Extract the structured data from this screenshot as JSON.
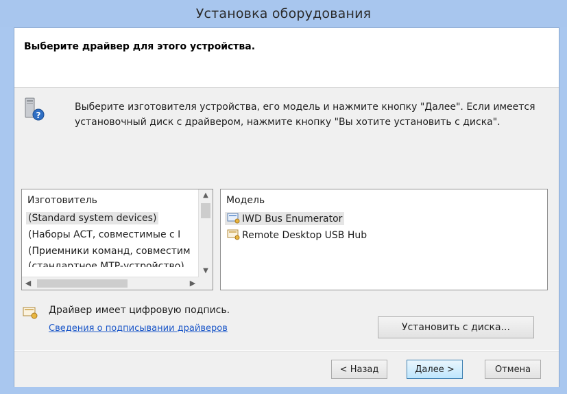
{
  "window": {
    "title": "Установка оборудования"
  },
  "header": {
    "heading": "Выберите драйвер для этого устройства."
  },
  "instructions": "Выберите изготовителя устройства, его модель и нажмите кнопку \"Далее\". Если имеется установочный диск с драйвером, нажмите кнопку \"Вы хотите установить с диска\".",
  "manufacturer_list": {
    "header": "Изготовитель",
    "items": [
      {
        "label": "(Standard system devices)",
        "selected": true
      },
      {
        "label": "(Наборы ACT, совместимые с I"
      },
      {
        "label": "(Приемники команд, совместим"
      },
      {
        "label": "(стандартное MTP-устройство)"
      }
    ]
  },
  "model_list": {
    "header": "Модель",
    "items": [
      {
        "label": "IWD Bus Enumerator",
        "icon": "driver-signed-icon",
        "selected": true
      },
      {
        "label": "Remote Desktop USB Hub",
        "icon": "driver-signed-icon"
      }
    ]
  },
  "signature": {
    "text": "Драйвер имеет цифровую подпись.",
    "link": "Сведения о подписывании драйверов"
  },
  "buttons": {
    "have_disk": "Установить с диска...",
    "back": "< Назад",
    "next": "Далее >",
    "cancel": "Отмена"
  },
  "colors": {
    "titlebar": "#a8c6ee",
    "link": "#1a56c8"
  }
}
